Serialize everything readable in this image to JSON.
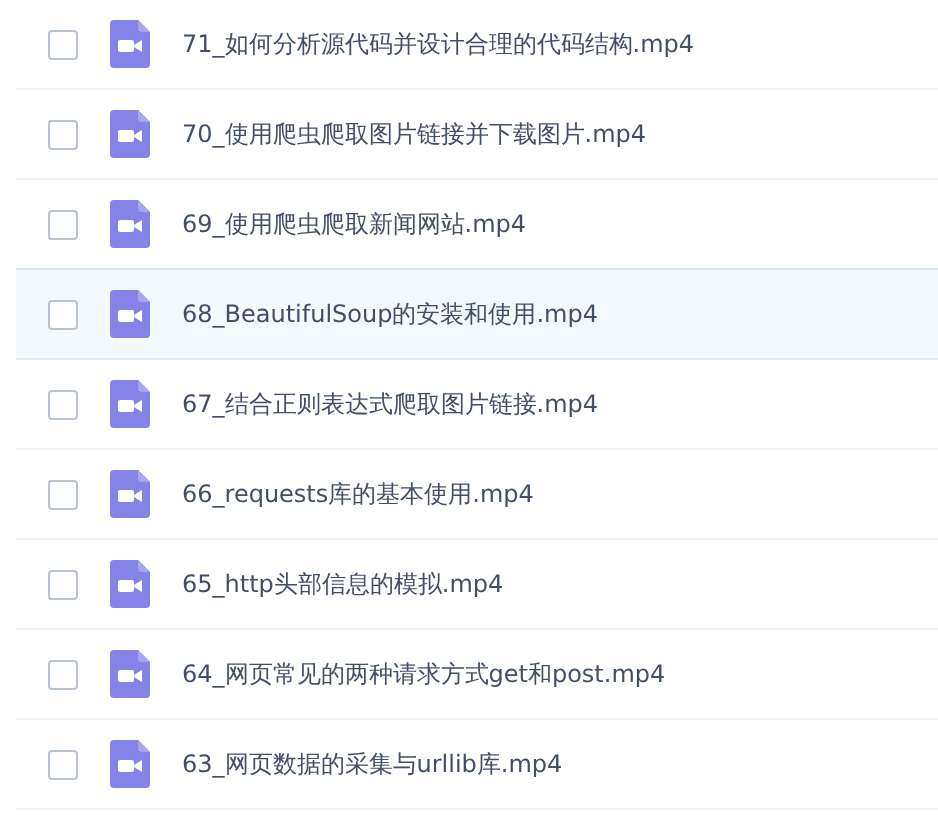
{
  "files": [
    {
      "name": "71_如何分析源代码并设计合理的代码结构.mp4",
      "checked": false,
      "highlighted": false
    },
    {
      "name": "70_使用爬虫爬取图片链接并下载图片.mp4",
      "checked": false,
      "highlighted": false
    },
    {
      "name": "69_使用爬虫爬取新闻网站.mp4",
      "checked": false,
      "highlighted": false
    },
    {
      "name": "68_BeautifulSoup的安装和使用.mp4",
      "checked": false,
      "highlighted": true
    },
    {
      "name": "67_结合正则表达式爬取图片链接.mp4",
      "checked": false,
      "highlighted": false
    },
    {
      "name": "66_requests库的基本使用.mp4",
      "checked": false,
      "highlighted": false
    },
    {
      "name": "65_http头部信息的模拟.mp4",
      "checked": false,
      "highlighted": false
    },
    {
      "name": "64_网页常见的两种请求方式get和post.mp4",
      "checked": false,
      "highlighted": false
    },
    {
      "name": "63_网页数据的采集与urllib库.mp4",
      "checked": false,
      "highlighted": false
    }
  ]
}
